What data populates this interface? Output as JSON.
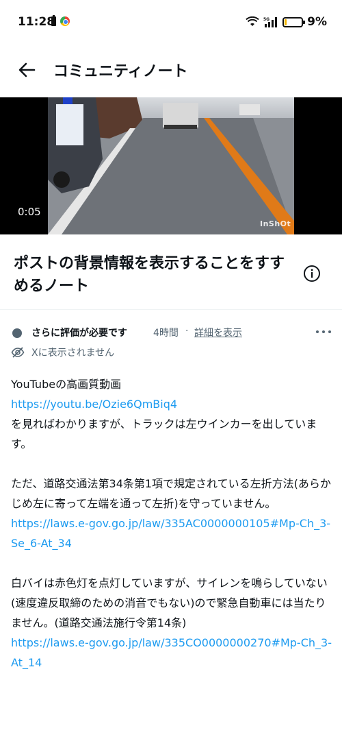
{
  "status_bar": {
    "time": "11:28",
    "network": "5G",
    "battery": "9%"
  },
  "header": {
    "title": "コミュニティノート",
    "back_icon": "arrow-left-icon"
  },
  "video": {
    "time": "0:05",
    "watermark": "InShOt"
  },
  "note": {
    "title": "ポストの背景情報を表示することをすすめるノート",
    "info_icon": "info-icon",
    "status": "さらに評価が必要です",
    "time": "4時間",
    "separator": "·",
    "details_link": "詳細を表示",
    "visibility": "Xに表示されません",
    "body": {
      "p1_line1": "YouTubeの高画質動画",
      "p1_link": "https://youtu.be/Ozie6QmBiq4",
      "p1_line2": "を見ればわかりますが、トラックは左ウインカーを出しています。",
      "p2_text": "ただ、道路交通法第34条第1項で規定されている左折方法(あらかじめ左に寄って左端を通って左折)を守っていません。",
      "p2_link": "https://laws.e-gov.go.jp/law/335AC0000000105#Mp-Ch_3-Se_6-At_34",
      "p3_text": "白バイは赤色灯を点灯していますが、サイレンを鳴らしていない(速度違反取締のための消音でもない)ので緊急自動車には当たりません。(道路交通法施行令第14条)",
      "p3_link": "https://laws.e-gov.go.jp/law/335CO0000000270#Mp-Ch_3-At_14"
    }
  },
  "colors": {
    "link": "#1d9bf0",
    "secondary_text": "#536471",
    "primary_text": "#0f1419"
  }
}
